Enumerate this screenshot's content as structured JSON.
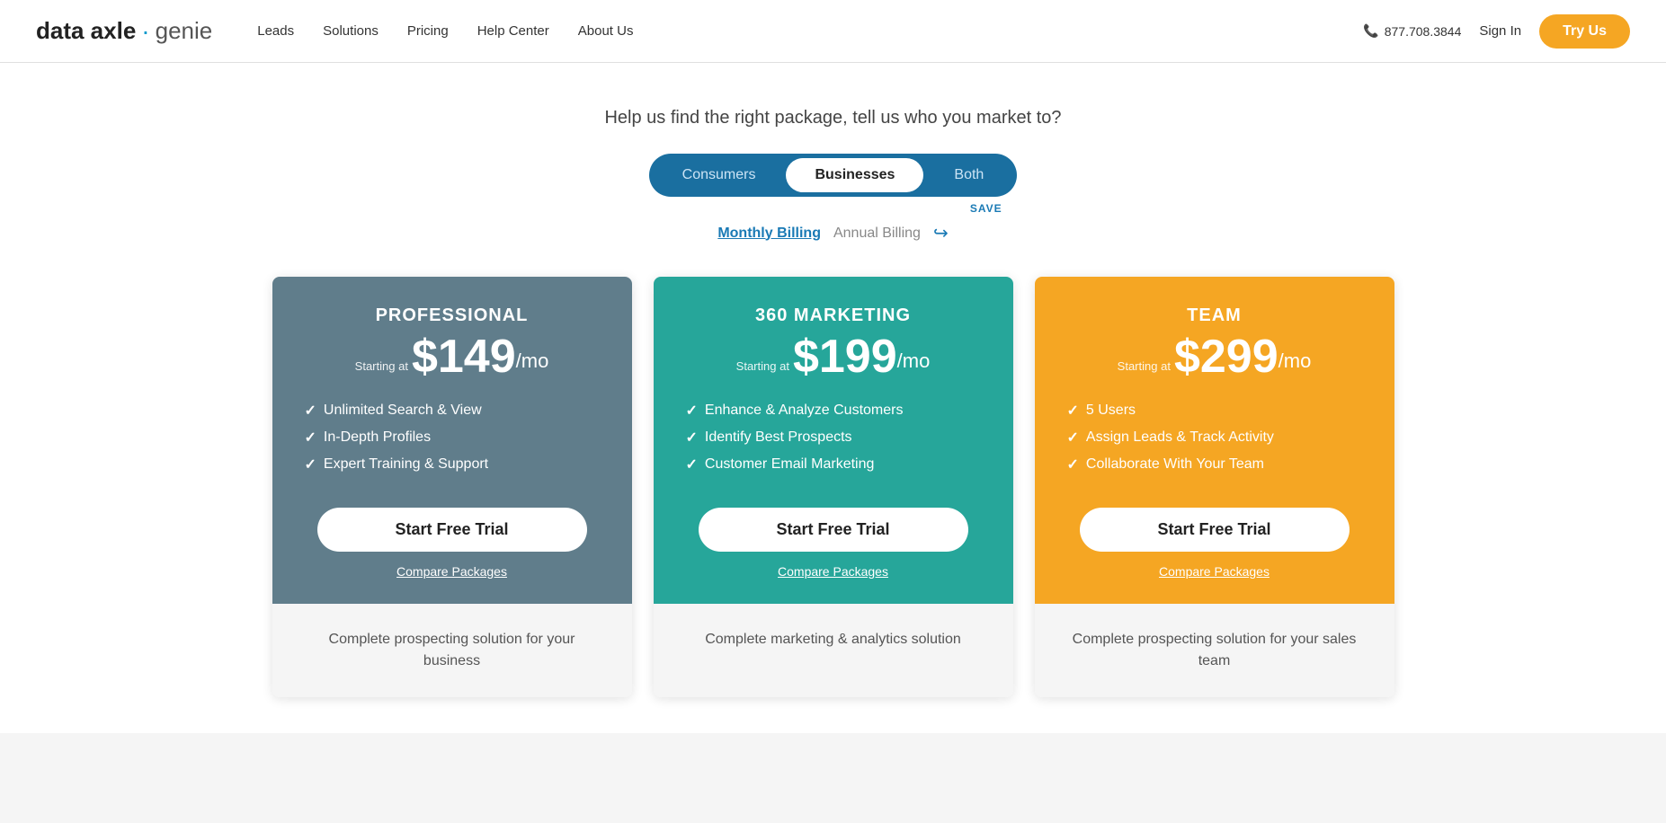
{
  "navbar": {
    "logo": {
      "brand": "data axle",
      "separator": "·",
      "product": "genie"
    },
    "links": [
      {
        "id": "leads",
        "label": "Leads"
      },
      {
        "id": "solutions",
        "label": "Solutions"
      },
      {
        "id": "pricing",
        "label": "Pricing"
      },
      {
        "id": "help-center",
        "label": "Help Center"
      },
      {
        "id": "about-us",
        "label": "About Us"
      }
    ],
    "phone": "877.708.3844",
    "signin_label": "Sign In",
    "try_us_label": "Try Us"
  },
  "headline": "Help us find the right package, tell us who you market to?",
  "audience_toggle": {
    "options": [
      {
        "id": "consumers",
        "label": "Consumers",
        "active": false
      },
      {
        "id": "businesses",
        "label": "Businesses",
        "active": true
      },
      {
        "id": "both",
        "label": "Both",
        "active": false
      }
    ]
  },
  "billing_toggle": {
    "monthly_label": "Monthly Billing",
    "annual_label": "Annual Billing",
    "save_label": "SAVE",
    "active": "monthly"
  },
  "plans": [
    {
      "id": "professional",
      "name": "PROFESSIONAL",
      "starting_at": "Starting at",
      "price": "$149",
      "per": "/mo",
      "features": [
        "Unlimited Search & View",
        "In-Depth Profiles",
        "Expert Training & Support"
      ],
      "cta_label": "Start Free Trial",
      "compare_label": "Compare Packages",
      "description": "Complete prospecting solution for your business",
      "color_class": "professional"
    },
    {
      "id": "marketing360",
      "name": "360 MARKETING",
      "starting_at": "Starting at",
      "price": "$199",
      "per": "/mo",
      "features": [
        "Enhance & Analyze Customers",
        "Identify Best Prospects",
        "Customer Email Marketing"
      ],
      "cta_label": "Start Free Trial",
      "compare_label": "Compare Packages",
      "description": "Complete marketing & analytics solution",
      "color_class": "marketing"
    },
    {
      "id": "team",
      "name": "TEAM",
      "starting_at": "Starting at",
      "price": "$299",
      "per": "/mo",
      "features": [
        "5 Users",
        "Assign Leads & Track Activity",
        "Collaborate With Your Team"
      ],
      "cta_label": "Start Free Trial",
      "compare_label": "Compare Packages",
      "description": "Complete prospecting solution for your sales team",
      "color_class": "team"
    }
  ]
}
